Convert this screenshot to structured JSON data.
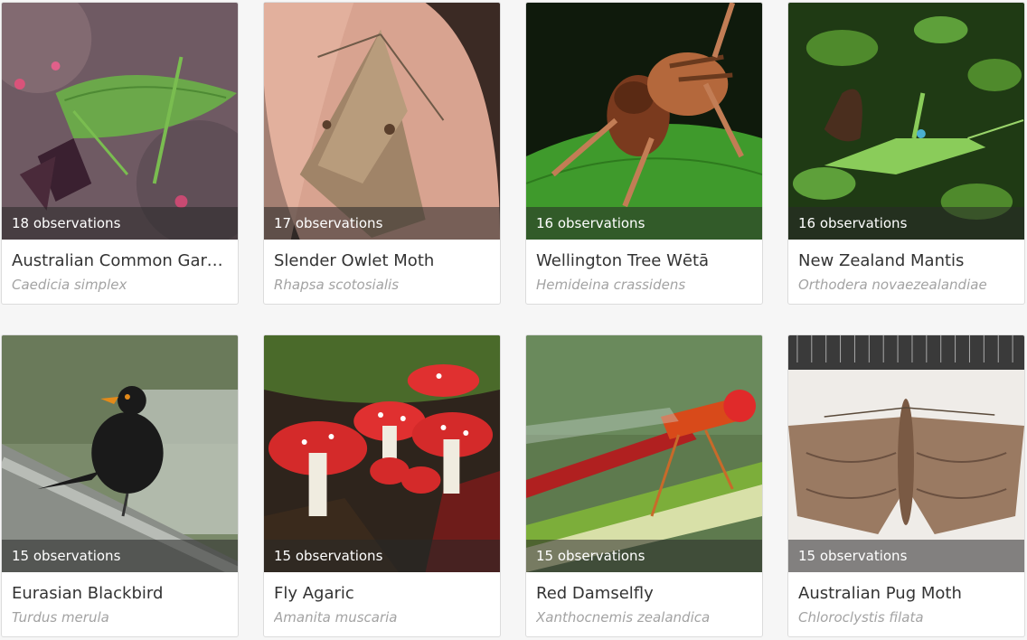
{
  "cards": [
    {
      "observations": "18 observations",
      "common_name": "Australian Common Garde…",
      "scientific_name": "Caedicia simplex"
    },
    {
      "observations": "17 observations",
      "common_name": "Slender Owlet Moth",
      "scientific_name": "Rhapsa scotosialis"
    },
    {
      "observations": "16 observations",
      "common_name": "Wellington Tree Wētā",
      "scientific_name": "Hemideina crassidens"
    },
    {
      "observations": "16 observations",
      "common_name": "New Zealand Mantis",
      "scientific_name": "Orthodera novaezealandiae"
    },
    {
      "observations": "15 observations",
      "common_name": "Eurasian Blackbird",
      "scientific_name": "Turdus merula"
    },
    {
      "observations": "15 observations",
      "common_name": "Fly Agaric",
      "scientific_name": "Amanita muscaria"
    },
    {
      "observations": "15 observations",
      "common_name": "Red Damselfly",
      "scientific_name": "Xanthocnemis zealandica"
    },
    {
      "observations": "15 observations",
      "common_name": "Australian Pug Moth",
      "scientific_name": "Chloroclystis filata"
    }
  ],
  "colors": {
    "page_background": "#f6f6f6",
    "card_background": "#ffffff",
    "common_name_text": "#333333",
    "scientific_name_text": "#a3a3a3"
  }
}
